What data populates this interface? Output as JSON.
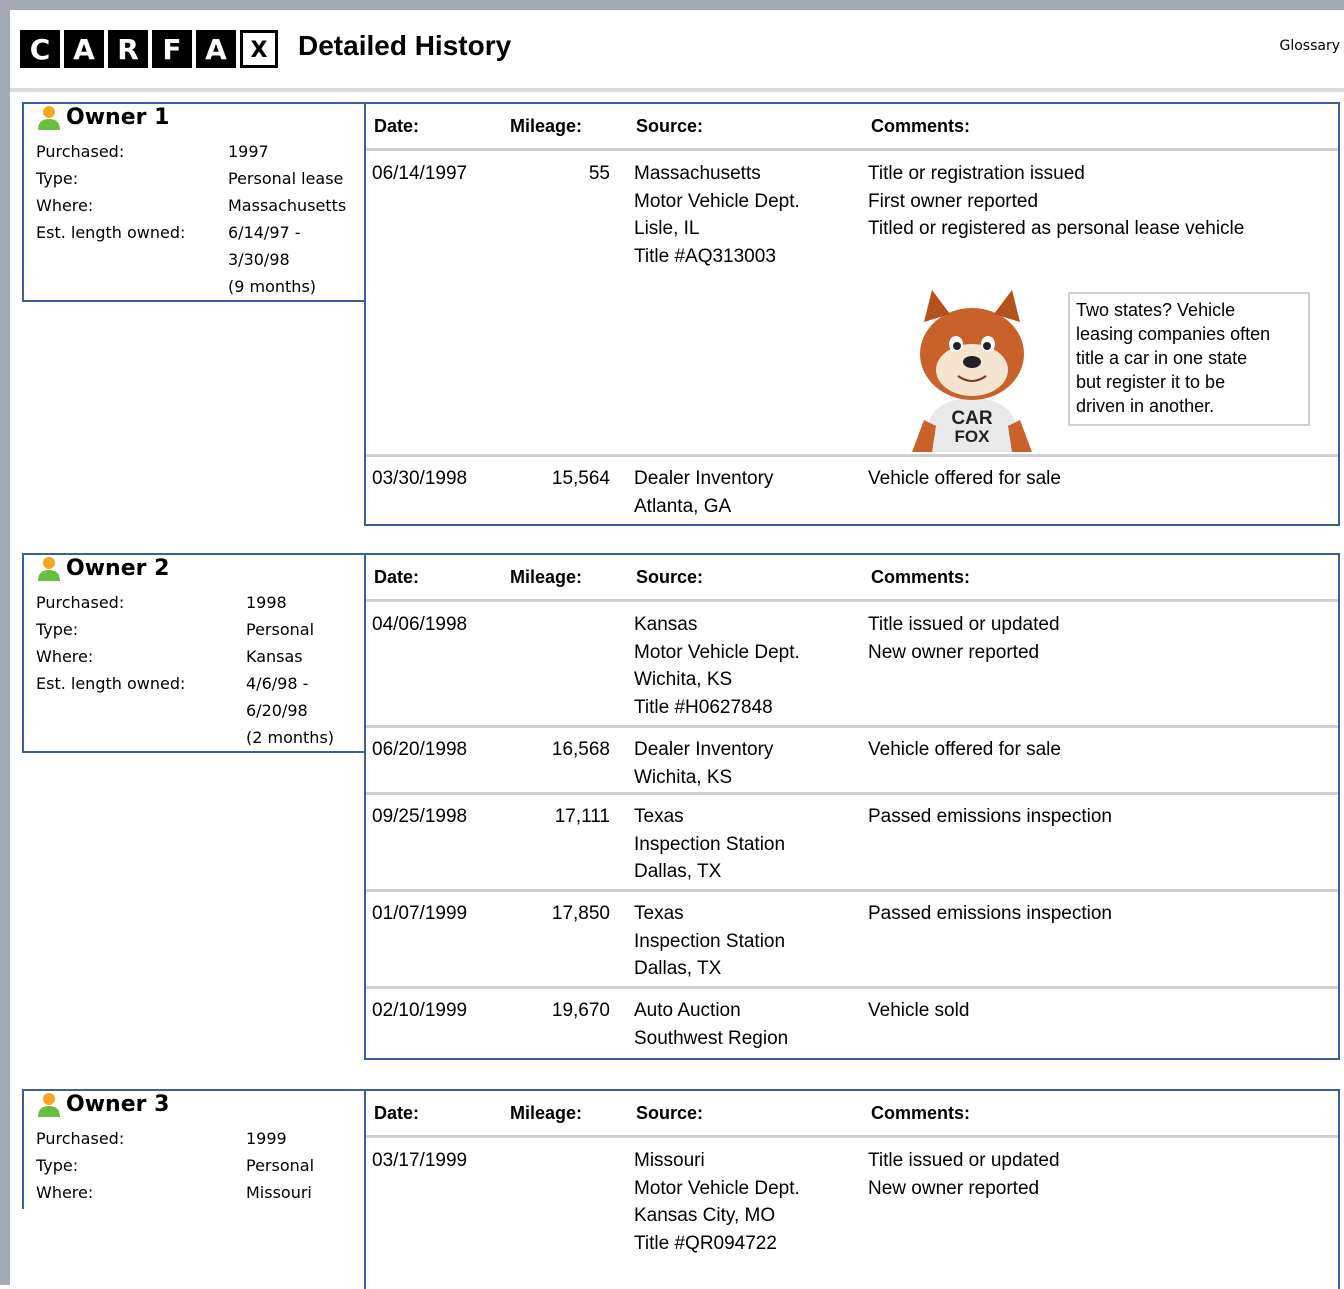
{
  "header": {
    "logo_letters": [
      "C",
      "A",
      "R",
      "F",
      "A",
      "X"
    ],
    "title": "Detailed History",
    "glossary_link": "Glossary"
  },
  "colors": {
    "frame": "#a3acb5",
    "table_border": "#3a5f9a",
    "row_separator": "#d0d0d0"
  },
  "owners": [
    {
      "label": "Owner 1",
      "icon": "person-icon",
      "fields": [
        {
          "label": "Purchased:",
          "value": "1997"
        },
        {
          "label": "Type:",
          "value": "Personal lease"
        },
        {
          "label": "Where:",
          "value": "Massachusetts"
        },
        {
          "label": "Est. length owned:",
          "value_lines": [
            "6/14/97 -",
            "3/30/98",
            "(9 months)"
          ]
        }
      ],
      "columns": [
        "Date:",
        "Mileage:",
        "Source:",
        "Comments:"
      ],
      "records": [
        {
          "date": "06/14/1997",
          "mileage": "55",
          "source": [
            "Massachusetts",
            "Motor Vehicle Dept.",
            "Lisle, IL",
            "Title #AQ313003"
          ],
          "comments": [
            "Title or registration issued",
            "First owner reported",
            "Titled or registered as personal lease vehicle"
          ]
        },
        {
          "date": "03/30/1998",
          "mileage": "15,564",
          "source": [
            "Dealer Inventory",
            "Atlanta, GA"
          ],
          "comments": [
            "Vehicle offered for sale"
          ]
        }
      ],
      "tip": {
        "mascot": "carfox-mascot",
        "mascot_shirt": [
          "CAR",
          "FOX"
        ],
        "text": [
          "Two states? Vehicle",
          "leasing companies often",
          "title a car in one state",
          "but register it to be",
          "driven in another."
        ]
      }
    },
    {
      "label": "Owner 2",
      "icon": "person-icon",
      "fields": [
        {
          "label": "Purchased:",
          "value": "1998"
        },
        {
          "label": "Type:",
          "value": "Personal"
        },
        {
          "label": "Where:",
          "value": "Kansas"
        },
        {
          "label": "Est. length owned:",
          "value_lines": [
            "4/6/98 -",
            "6/20/98",
            "(2 months)"
          ]
        }
      ],
      "columns": [
        "Date:",
        "Mileage:",
        "Source:",
        "Comments:"
      ],
      "records": [
        {
          "date": "04/06/1998",
          "mileage": "",
          "source": [
            "Kansas",
            "Motor Vehicle Dept.",
            "Wichita, KS",
            "Title #H0627848"
          ],
          "comments": [
            "Title issued or updated",
            "New owner reported"
          ]
        },
        {
          "date": "06/20/1998",
          "mileage": "16,568",
          "source": [
            "Dealer Inventory",
            "Wichita, KS"
          ],
          "comments": [
            "Vehicle offered for sale"
          ]
        },
        {
          "date": "09/25/1998",
          "mileage": "17,111",
          "source": [
            "Texas",
            "Inspection Station",
            "Dallas, TX"
          ],
          "comments": [
            "Passed emissions inspection"
          ]
        },
        {
          "date": "01/07/1999",
          "mileage": "17,850",
          "source": [
            "Texas",
            "Inspection Station",
            "Dallas, TX"
          ],
          "comments": [
            "Passed emissions inspection"
          ]
        },
        {
          "date": "02/10/1999",
          "mileage": "19,670",
          "source": [
            "Auto Auction",
            "Southwest Region"
          ],
          "comments": [
            "Vehicle sold"
          ]
        }
      ]
    },
    {
      "label": "Owner 3",
      "icon": "person-icon",
      "fields": [
        {
          "label": "Purchased:",
          "value": "1999"
        },
        {
          "label": "Type:",
          "value": "Personal"
        },
        {
          "label": "Where:",
          "value": "Missouri"
        }
      ],
      "columns": [
        "Date:",
        "Mileage:",
        "Source:",
        "Comments:"
      ],
      "records": [
        {
          "date": "03/17/1999",
          "mileage": "",
          "source": [
            "Missouri",
            "Motor Vehicle Dept.",
            "Kansas City, MO",
            "Title #QR094722"
          ],
          "comments": [
            "Title issued or updated",
            "New owner reported"
          ]
        }
      ]
    }
  ]
}
